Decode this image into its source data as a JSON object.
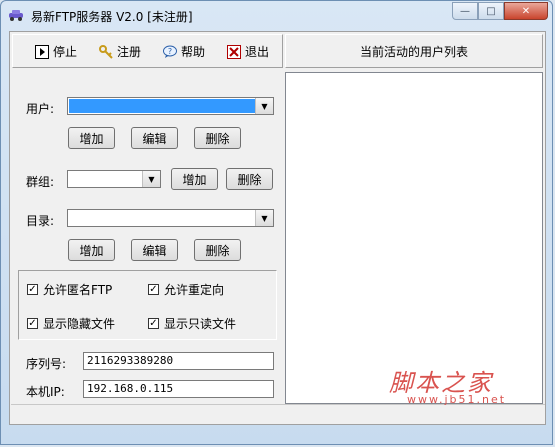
{
  "window": {
    "title": "易新FTP服务器 V2.0 [未注册]",
    "controls": {
      "minimize": "—",
      "maximize": "□",
      "close": "✕"
    }
  },
  "toolbar": {
    "stop": "停止",
    "register": "注册",
    "help": "帮助",
    "exit": "退出"
  },
  "form": {
    "user_label": "用户:",
    "group_label": "群组:",
    "directory_label": "目录:",
    "add": "增加",
    "edit": "编辑",
    "delete": "删除"
  },
  "options": {
    "allow_anonymous": "允许匿名FTP",
    "allow_redirect": "允许重定向",
    "show_hidden": "显示隐藏文件",
    "show_readonly": "显示只读文件",
    "checked_mark": "✓"
  },
  "info": {
    "serial_label": "序列号:",
    "serial_value": "2116293389280",
    "ip_label": "本机IP:",
    "ip_value": "192.168.0.115"
  },
  "right_panel": {
    "title": "当前活动的用户列表"
  },
  "watermark": {
    "main": "脚本之家",
    "sub": "www.jb51.net"
  },
  "colors": {
    "selection": "#3399ff",
    "watermark": "#d9534f",
    "close_button": "#c9442d"
  }
}
